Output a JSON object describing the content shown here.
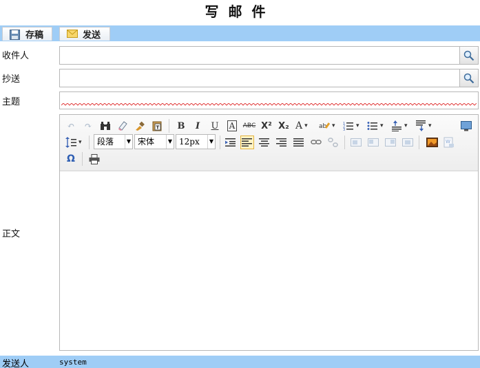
{
  "page": {
    "title": "写邮件"
  },
  "actions": {
    "save_label": "存稿",
    "send_label": "发送"
  },
  "form": {
    "to_label": "收件人",
    "cc_label": "抄送",
    "subject_label": "主题",
    "body_label": "正文",
    "to_value": "",
    "cc_value": "",
    "subject_value": ""
  },
  "toolbar": {
    "paragraph_format": "段落",
    "font_family": "宋体",
    "font_size": "12px",
    "text_buttons": {
      "bold": "B",
      "italic": "I",
      "underline": "U",
      "font_border": "A",
      "strike": "ABC",
      "superscript": "X²",
      "subscript": "X₂",
      "font_color": "A",
      "special_char": "Ω"
    },
    "active_button": "align-left"
  },
  "footer": {
    "sender_label": "发送人",
    "sender_value": "system"
  },
  "colors": {
    "bar_blue": "#9fcdf6",
    "border_gray": "#b7b7b7",
    "toolbar_bg": "#efefef",
    "highlight": "#fff4c6"
  }
}
